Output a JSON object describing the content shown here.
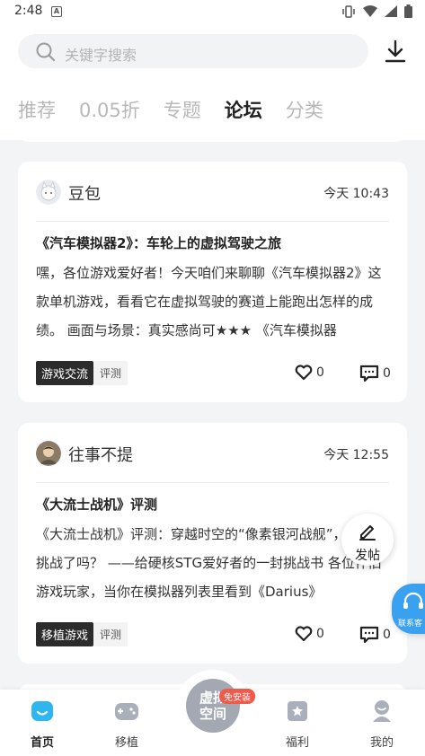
{
  "status_bar": {
    "time": "2:48",
    "app_badge": "A"
  },
  "search": {
    "placeholder": "关键字搜索"
  },
  "tabs": [
    {
      "label": "推荐",
      "active": false
    },
    {
      "label": "0.05折",
      "active": false
    },
    {
      "label": "专题",
      "active": false
    },
    {
      "label": "论坛",
      "active": true
    },
    {
      "label": "分类",
      "active": false
    }
  ],
  "posts": [
    {
      "author": "豆包",
      "time": "今天 10:43",
      "title": "《汽车模拟器2》：车轮上的虚拟驾驶之旅",
      "excerpt": "嘿，各位游戏爱好者！今天咱们来聊聊《汽车模拟器2》这款单机游戏，看看它在虚拟驾驶的赛道上能跑出怎样的成绩。 画面与场景：真实感尚可★★★ 《汽车模拟器",
      "tag_primary": "游戏交流",
      "tag_secondary": "评测",
      "likes": "0",
      "comments": "0"
    },
    {
      "author": "往事不提",
      "time": "今天 12:55",
      "title": "《大流士战机》评测",
      "excerpt": "《大流士战机》评测：穿越时空的“像素银河战舰”，准备好挑战了吗？ ——给硬核STG爱好者的一封挑战书 各位怀旧游戏玩家，当你在模拟器列表里看到《Darius》",
      "tag_primary": "移植游戏",
      "tag_secondary": "评测",
      "likes": "0",
      "comments": "0"
    }
  ],
  "floating": {
    "post_label": "发帖",
    "support_label": "联系客"
  },
  "bottom_nav": {
    "home": "首页",
    "port": "移植",
    "center_line1": "虚拟",
    "center_line2": "空间",
    "center_badge": "免安装",
    "welfare": "福利",
    "mine": "我的"
  },
  "colors": {
    "accent": "#2fb5f0",
    "tag_dark": "#2c2c2c",
    "badge": "#f05a4a",
    "support": "#3aa0f0"
  }
}
